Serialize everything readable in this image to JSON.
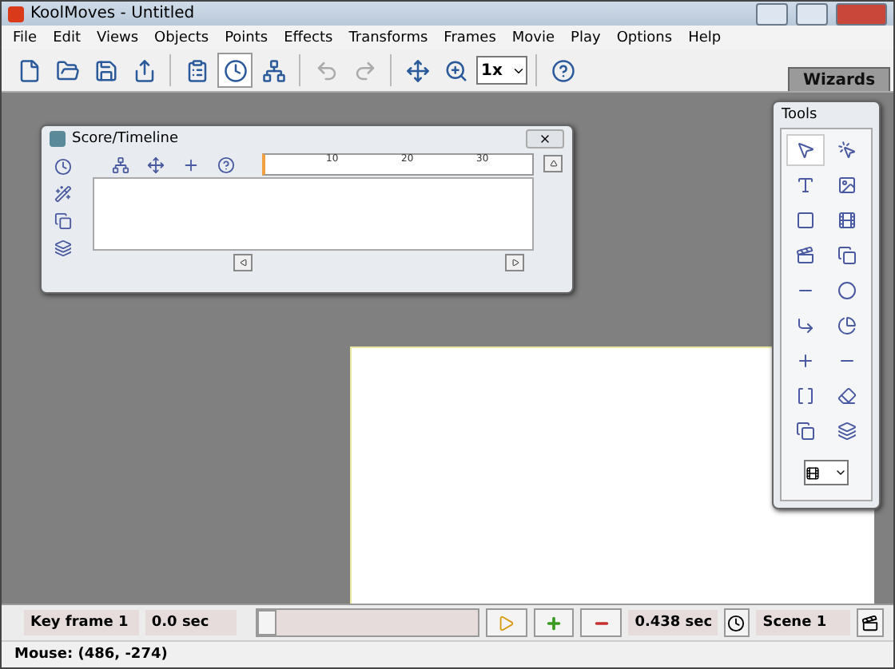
{
  "window": {
    "title": "KoolMoves - Untitled"
  },
  "menu": [
    "File",
    "Edit",
    "Views",
    "Objects",
    "Points",
    "Effects",
    "Transforms",
    "Frames",
    "Movie",
    "Play",
    "Options",
    "Help"
  ],
  "toolbar": {
    "groups": [
      [
        {
          "pressed": false,
          "disabled": false
        },
        {
          "pressed": false,
          "disabled": false
        },
        {
          "pressed": false,
          "disabled": false
        },
        {
          "pressed": false,
          "disabled": false
        }
      ],
      [
        {
          "pressed": false,
          "disabled": false
        },
        {
          "pressed": true,
          "disabled": false
        },
        {
          "pressed": false,
          "disabled": false
        }
      ],
      [
        {
          "pressed": false,
          "disabled": true
        },
        {
          "pressed": false,
          "disabled": true
        }
      ],
      [
        {
          "pressed": false,
          "disabled": false
        },
        {
          "pressed": false,
          "disabled": false
        }
      ]
    ],
    "zoom": "1x",
    "wizards": "Wizards"
  },
  "score": {
    "title": "Score/Timeline",
    "ruler_labels": [
      "10",
      "20",
      "30"
    ]
  },
  "tools": {
    "title": "Tools",
    "items": [
      {
        "selected": true
      },
      {
        "selected": false
      },
      {
        "selected": false
      },
      {
        "selected": false
      },
      {
        "selected": false
      },
      {
        "selected": false
      },
      {
        "selected": false
      },
      {
        "selected": false
      },
      {
        "selected": false
      },
      {
        "selected": false
      },
      {
        "selected": false
      },
      {
        "selected": false
      },
      {
        "selected": false
      },
      {
        "selected": false
      },
      {
        "selected": false
      },
      {
        "selected": false
      },
      {
        "selected": false
      },
      {
        "selected": false
      }
    ]
  },
  "bottom": {
    "keyframe": "Key frame 1",
    "time": "0.0 sec",
    "slider": {
      "level": 0
    },
    "duration": "0.438 sec",
    "scene": "Scene 1"
  },
  "status": "Mouse: (486, -274)"
}
